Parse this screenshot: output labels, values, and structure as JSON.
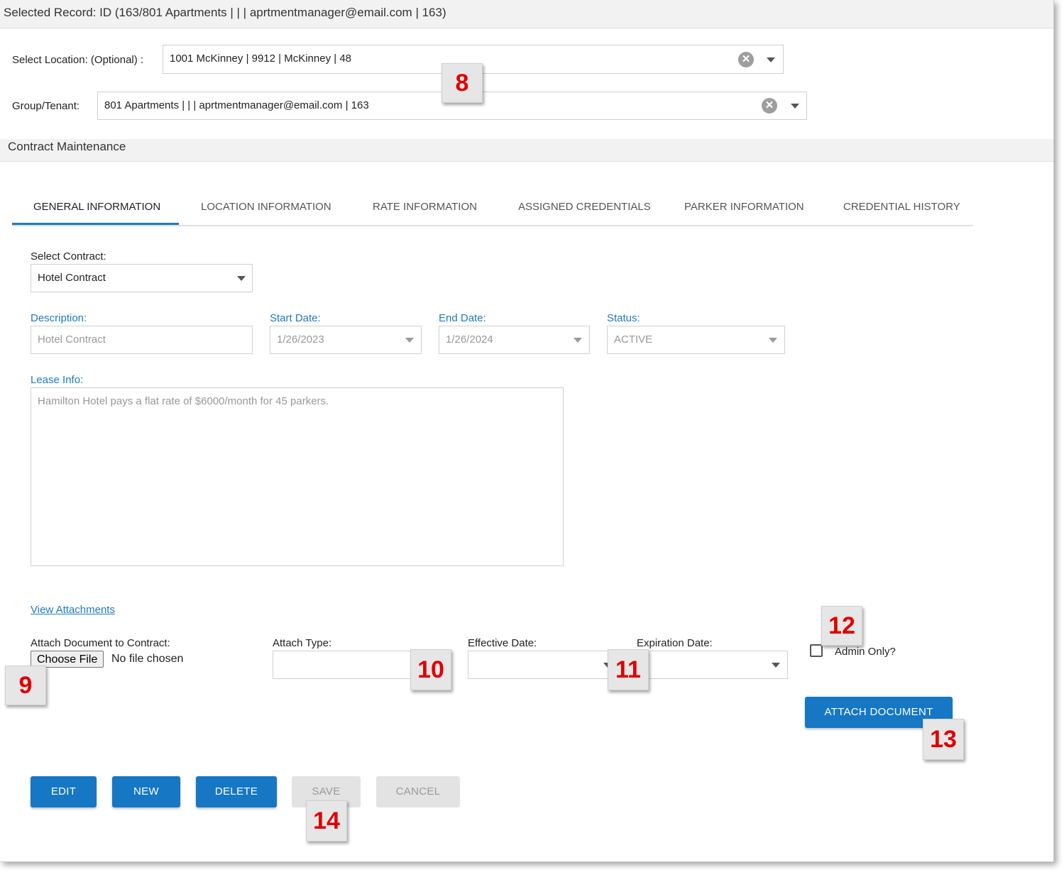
{
  "header": {
    "selected_record": "Selected Record: ID (163/801 Apartments |  |  | aprtmentmanager@email.com  | 163)"
  },
  "location": {
    "label": "Select Location: (Optional) :",
    "value": "1001 McKinney | 9912 | McKinney | 48"
  },
  "group": {
    "label": "Group/Tenant:",
    "value": "801 Apartments |  |  | aprtmentmanager@email.com | 163"
  },
  "section": {
    "title": "Contract Maintenance"
  },
  "tabs": [
    {
      "label": "GENERAL INFORMATION"
    },
    {
      "label": "LOCATION INFORMATION"
    },
    {
      "label": "RATE INFORMATION"
    },
    {
      "label": "ASSIGNED CREDENTIALS"
    },
    {
      "label": "PARKER INFORMATION"
    },
    {
      "label": "CREDENTIAL HISTORY"
    }
  ],
  "contract": {
    "label": "Select Contract:",
    "value": "Hotel Contract"
  },
  "description": {
    "label": "Description:",
    "value": "Hotel Contract"
  },
  "start_date": {
    "label": "Start Date:",
    "value": "1/26/2023"
  },
  "end_date": {
    "label": "End Date:",
    "value": "1/26/2024"
  },
  "status": {
    "label": "Status:",
    "value": "ACTIVE"
  },
  "lease": {
    "label": "Lease Info:",
    "value": "Hamilton Hotel pays a flat rate of $6000/month for 45 parkers."
  },
  "attachments": {
    "view_link": "View Attachments",
    "attach_label": "Attach Document to Contract:",
    "choose_file": "Choose File",
    "no_file": "No file chosen",
    "attach_type_label": "Attach Type:",
    "effective_label": "Effective Date:",
    "expiration_label": "Expiration Date:",
    "admin_only_label": "Admin Only?",
    "attach_button": "ATTACH DOCUMENT"
  },
  "actions": {
    "edit": "EDIT",
    "new": "NEW",
    "delete": "DELETE",
    "save": "SAVE",
    "cancel": "CANCEL"
  },
  "callouts": [
    "8",
    "9",
    "10",
    "11",
    "12",
    "13",
    "14"
  ],
  "colors": {
    "accent": "#1677c5",
    "callout_text": "#e00000"
  }
}
